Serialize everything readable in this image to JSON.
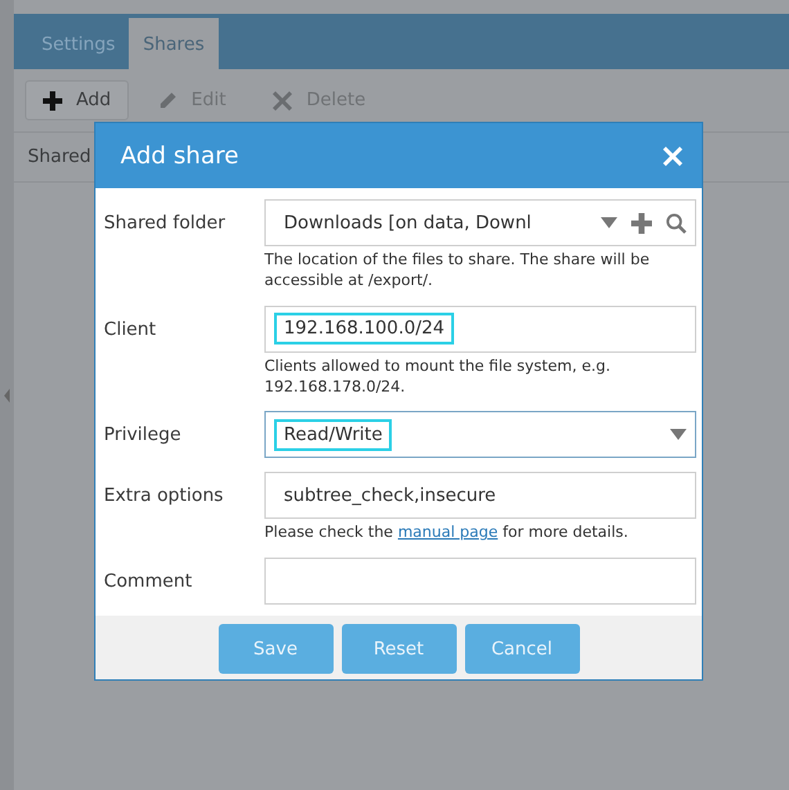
{
  "tabs": [
    {
      "label": "Settings",
      "selected": false
    },
    {
      "label": "Shares",
      "selected": true
    }
  ],
  "toolbar": [
    {
      "label": "Add",
      "kind": "add",
      "disabled": false
    },
    {
      "label": "Edit",
      "kind": "edit",
      "disabled": true
    },
    {
      "label": "Delete",
      "kind": "delete",
      "disabled": true
    }
  ],
  "table": {
    "columns": [
      "Shared"
    ]
  },
  "dialog": {
    "title": "Add share",
    "fields": [
      {
        "label": "Shared folder",
        "kind": "folder",
        "value": "Downloads [on data, Downl",
        "highlighted": false,
        "help": {
          "text": "The location of the files to share. The share will be accessible at /export/."
        }
      },
      {
        "label": "Client",
        "kind": "text",
        "value": "192.168.100.0/24",
        "highlighted": true,
        "help": {
          "text": "Clients allowed to mount the file system, e.g. 192.168.178.0/24."
        }
      },
      {
        "label": "Privilege",
        "kind": "select",
        "value": "Read/Write",
        "highlighted": true
      },
      {
        "label": "Extra options",
        "kind": "text",
        "value": "subtree_check,insecure",
        "highlighted": false,
        "help": {
          "text": "Please check the ",
          "link": "manual page",
          "after": " for more details."
        }
      },
      {
        "label": "Comment",
        "kind": "text",
        "highlighted": false
      }
    ],
    "buttons": [
      "Save",
      "Reset",
      "Cancel"
    ]
  }
}
